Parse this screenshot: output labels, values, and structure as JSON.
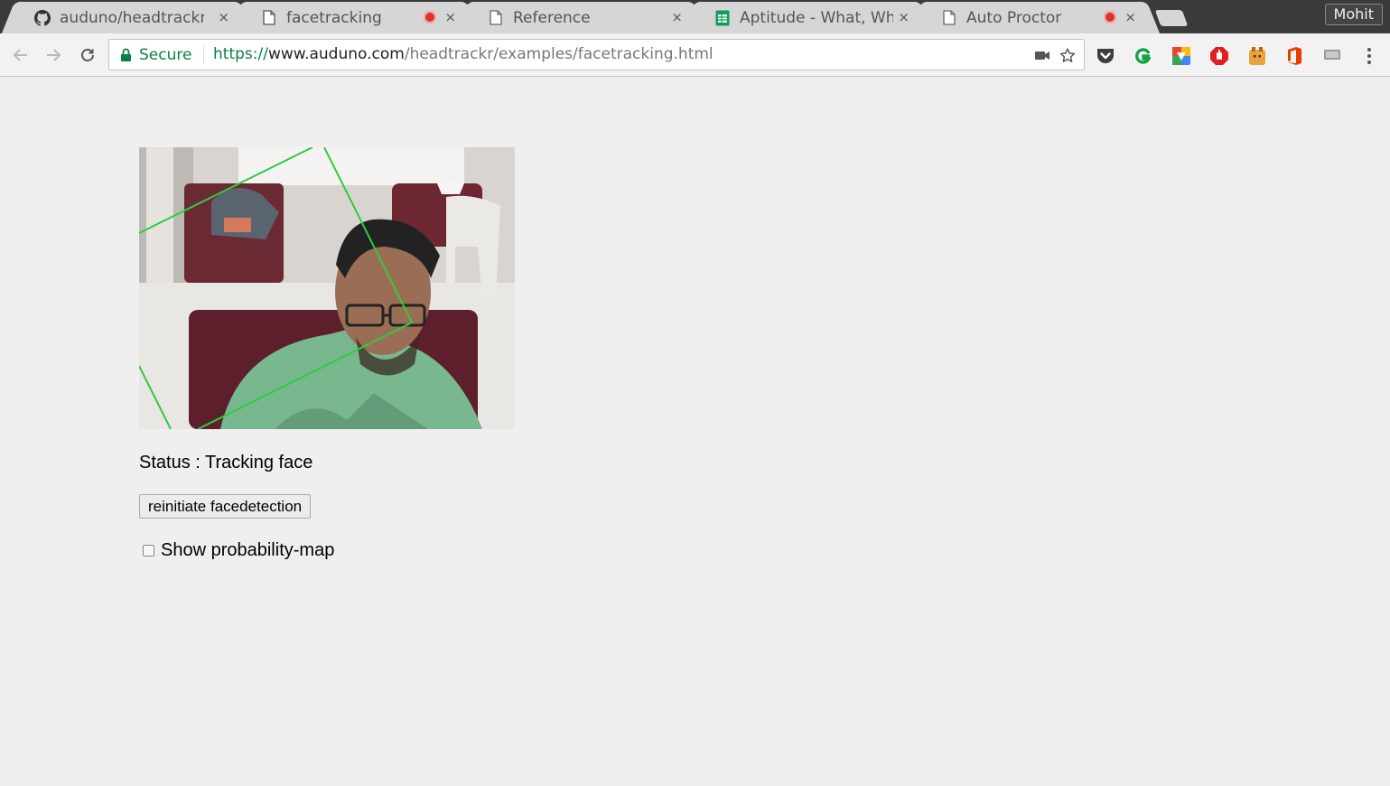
{
  "browser": {
    "tabs": [
      {
        "title": "auduno/headtrackr: J",
        "icon": "github-icon",
        "active": false,
        "recording": false
      },
      {
        "title": "facetracking",
        "icon": "page-icon",
        "active": true,
        "recording": true
      },
      {
        "title": "Reference",
        "icon": "page-icon",
        "active": false,
        "recording": false
      },
      {
        "title": "Aptitude - What, Why",
        "icon": "sheets-icon",
        "active": false,
        "recording": false
      },
      {
        "title": "Auto Proctor",
        "icon": "page-icon",
        "active": false,
        "recording": true
      }
    ],
    "close_glyph": "×",
    "profile_name": "Mohit",
    "security_label": "Secure",
    "url": {
      "scheme": "https://",
      "host": "www.auduno.com",
      "path": "/headtrackr/examples/facetracking.html"
    },
    "extensions": [
      "pocket-icon",
      "grammarly-icon",
      "drive-icon",
      "adblock-icon",
      "extension-face-icon",
      "office-icon",
      "cast-icon"
    ],
    "accent_color": "#0b8043"
  },
  "page": {
    "status_text": "Status : Tracking face",
    "reinit_button_label": "reinitiate facedetection",
    "checkbox_label": "Show probability-map",
    "checkbox_checked": false,
    "tracking_box_color": "#2ecc40"
  }
}
